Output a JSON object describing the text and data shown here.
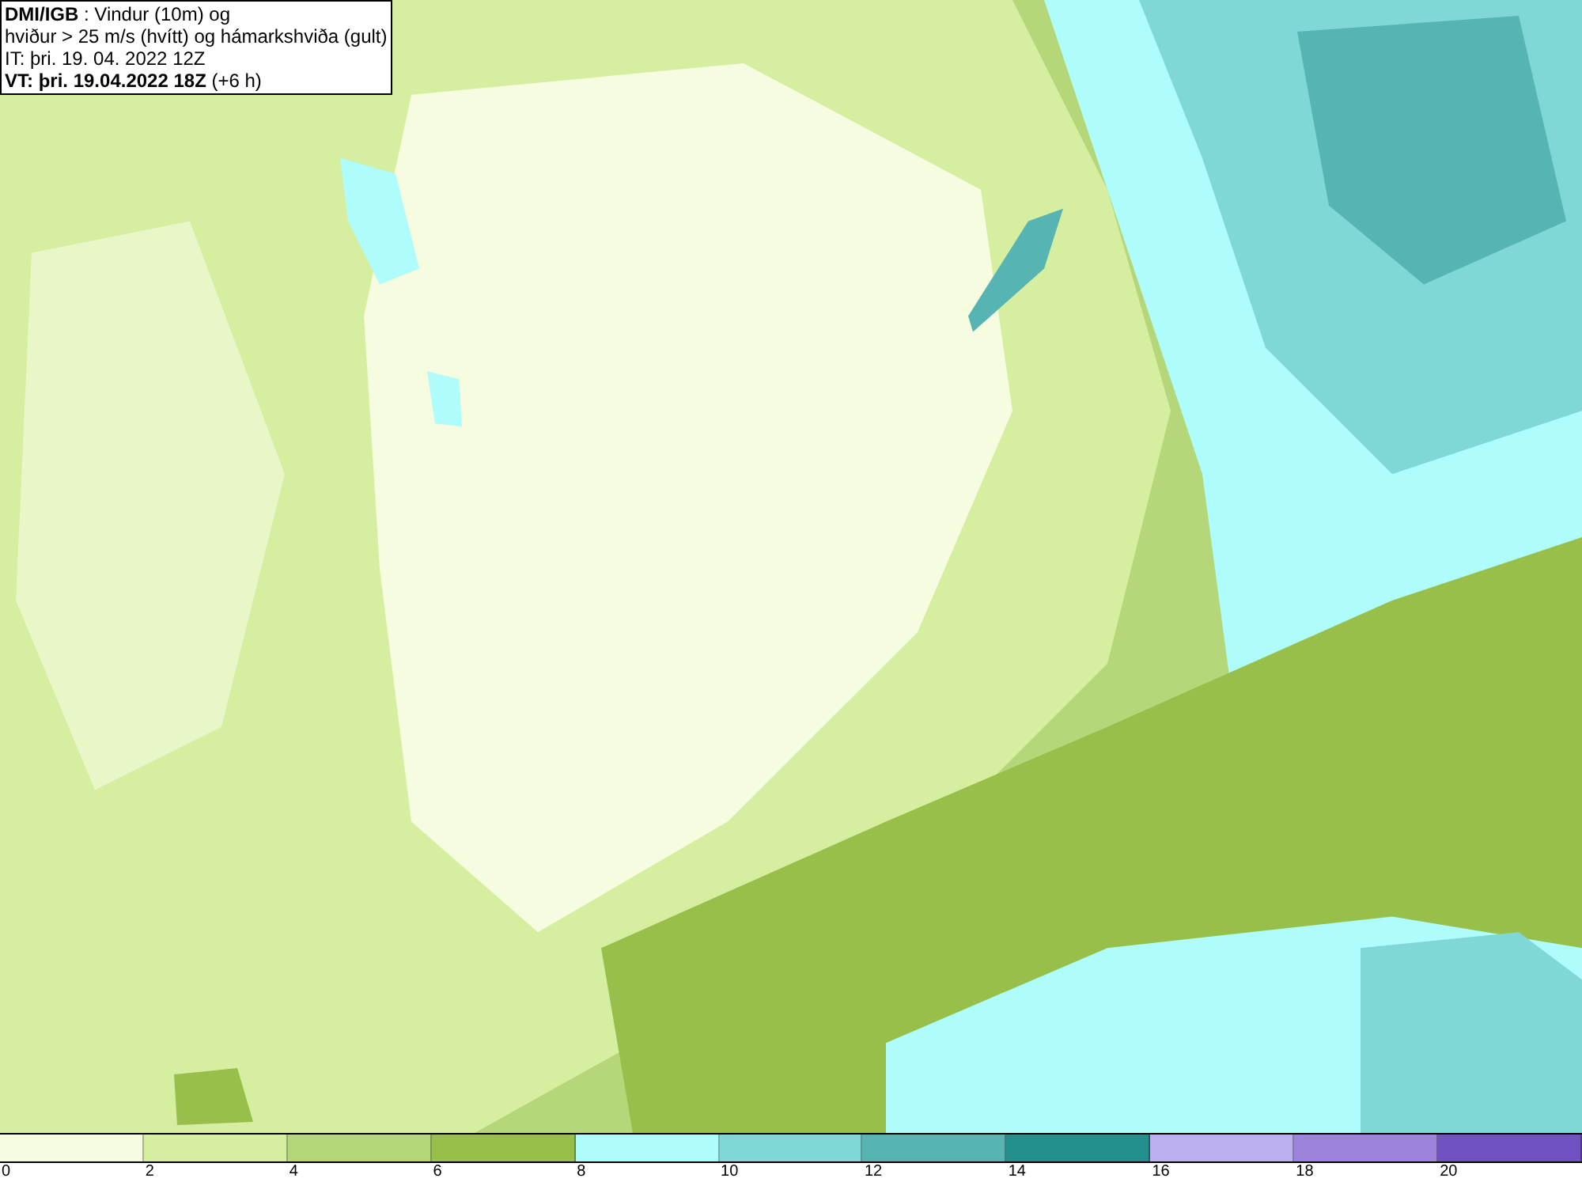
{
  "header": {
    "lines": [
      "**DMI/IGB** : Vindur (10m) og",
      "hviður > 25 m/s (hvítt) og hámarkshviða (gult)",
      "IT: þri. 19. 04. 2022 12Z",
      "**VT: þri. 19.04.2022 18Z** (+6 h)"
    ]
  },
  "legend": [
    {
      "label": "0",
      "color": "#f5fce0"
    },
    {
      "label": "2",
      "color": "#d5ee9f"
    },
    {
      "label": "4",
      "color": "#b5d779"
    },
    {
      "label": "6",
      "color": "#98bf4a"
    },
    {
      "label": "8",
      "color": "#aefcfc"
    },
    {
      "label": "10",
      "color": "#7fd8d6"
    },
    {
      "label": "12",
      "color": "#56b5b3"
    },
    {
      "label": "14",
      "color": "#238f8c"
    },
    {
      "label": "16",
      "color": "#bdb0f0"
    },
    {
      "label": "18",
      "color": "#9c84dc"
    },
    {
      "label": "20",
      "color": "#7152c2"
    }
  ]
}
